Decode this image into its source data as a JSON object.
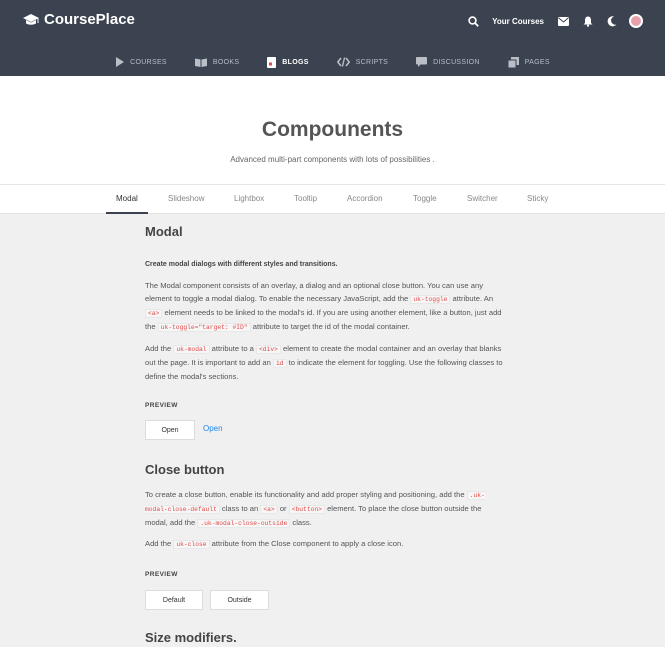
{
  "header": {
    "brand": "CoursePlace",
    "your_courses": "Your Courses",
    "icons": [
      "search-icon",
      "mail-icon",
      "bell-icon",
      "moon-icon",
      "avatar"
    ]
  },
  "subnav": [
    {
      "label": "COURSES",
      "icon": "play-icon"
    },
    {
      "label": "BOOKS",
      "icon": "book-icon"
    },
    {
      "label": "BLOGS",
      "icon": "blog-icon",
      "active": true
    },
    {
      "label": "SCRIPTS",
      "icon": "code-icon"
    },
    {
      "label": "DISCUSSION",
      "icon": "chat-icon"
    },
    {
      "label": "PAGES",
      "icon": "pages-icon"
    }
  ],
  "hero": {
    "title": "Compounents",
    "subtitle": "Advanced multi-part components with lots of possibilities ."
  },
  "tabs": [
    "Modal",
    "Slideshow",
    "Lightbox",
    "Tooltip",
    "Accordion",
    "Toggle",
    "Switcher",
    "Sticky"
  ],
  "modal": {
    "title": "Modal",
    "lead": "Create modal dialogs with different styles and transitions.",
    "p1": {
      "a": "The Modal component consists of an overlay, a dialog and an optional close button. You can use any element to toggle a modal dialog. To enable the necessary JavaScript, add the",
      "code1": "uk-toggle",
      "b": "attribute. An",
      "code2": "<a>",
      "c": "element needs to be linked to the modal's id. If you are using another element, like a button, just add the",
      "code3": "uk-toggle=\"target: #ID\"",
      "d": "attribute to target the id of the modal container."
    },
    "p2": {
      "a": "Add the",
      "code1": "uk-modal",
      "b": "attribute to a",
      "code2": "<div>",
      "c": "element to create the modal container and an overlay that blanks out the page. It is important to add an",
      "code3": "id",
      "d": "to indicate the element for toggling. Use the following classes to define the modal's sections."
    },
    "preview_label": "PREVIEW",
    "open_button": "Open",
    "open_link": "Open"
  },
  "close_button": {
    "title": "Close button",
    "p1": {
      "a": "To create a close button, enable its functionality and add proper styling and positioning, add the",
      "code1": ".uk-modal-close-default",
      "b": "class to an",
      "code2": "<a>",
      "c": "or",
      "code3": "<button>",
      "d": "element. To place the close button outside the modal, add the",
      "code4": ".uk-modal-close-outside",
      "e": "class."
    },
    "p2": {
      "a": "Add the",
      "code1": "uk-close",
      "b": "attribute from the Close component to apply a close icon."
    },
    "preview_label": "PREVIEW",
    "default_button": "Default",
    "outside_button": "Outside"
  },
  "size_modifiers": {
    "title": "Size modifiers."
  }
}
